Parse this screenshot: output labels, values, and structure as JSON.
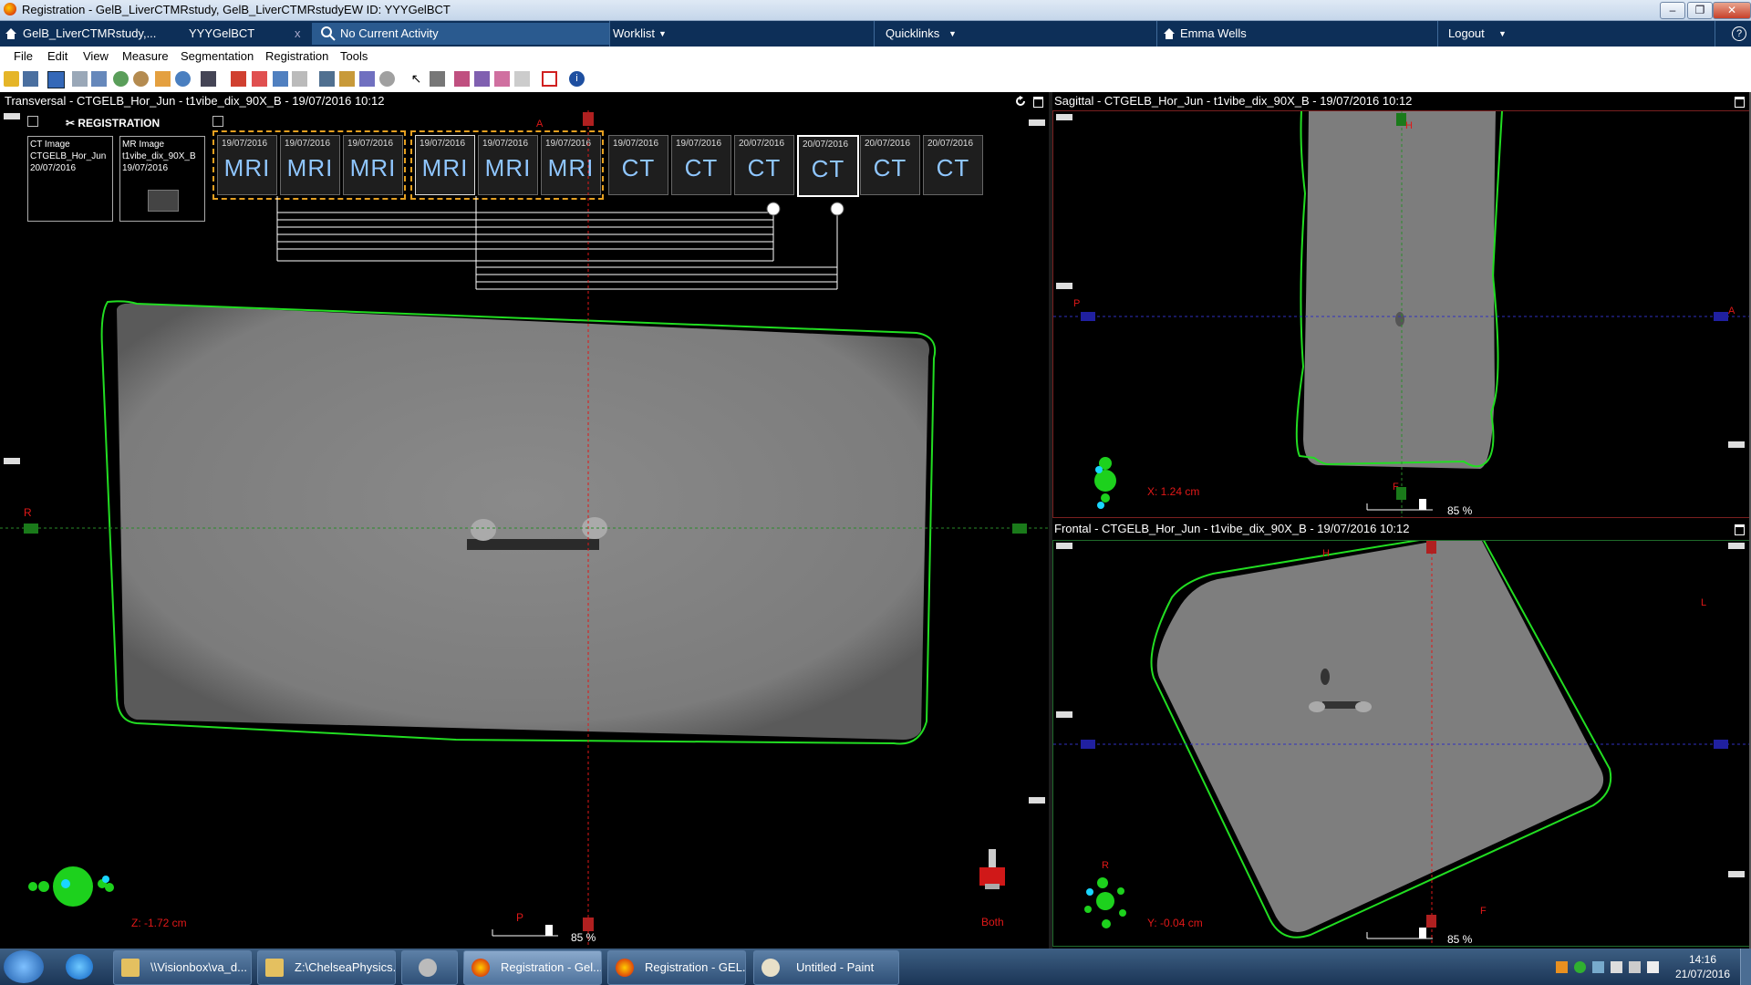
{
  "window": {
    "title": "Registration - GelB_LiverCTMRstudy, GelB_LiverCTMRstudyEW  ID: YYYGelBCT",
    "buttons": {
      "minimize": "–",
      "restore": "❐",
      "close": "✕"
    }
  },
  "navbar": {
    "patient_tab": "GelB_LiverCTMRstudy,...",
    "id_tab": "YYYGelBCT",
    "close_glyph": "x",
    "activity": "No Current Activity",
    "worklist": "Worklist",
    "quicklinks": "Quicklinks",
    "user": "Emma Wells",
    "logout": "Logout",
    "help": "?"
  },
  "menu": [
    "File",
    "Edit",
    "View",
    "Measure",
    "Segmentation",
    "Registration",
    "Tools"
  ],
  "transversal": {
    "header": "Transversal - CTGELB_Hor_Jun - t1vibe_dix_90X_B - 19/07/2016 10:12",
    "panel_title": "REGISTRATION",
    "ct_image": [
      "CT Image",
      "CTGELB_Hor_Jun",
      "20/07/2016"
    ],
    "mr_image": [
      "MR Image",
      "t1vibe_dix_90X_B",
      "19/07/2016"
    ],
    "thumbs": [
      {
        "date": "19/07/2016",
        "mod": "MRI"
      },
      {
        "date": "19/07/2016",
        "mod": "MRI"
      },
      {
        "date": "19/07/2016",
        "mod": "MRI"
      },
      {
        "date": "19/07/2016",
        "mod": "MRI"
      },
      {
        "date": "19/07/2016",
        "mod": "MRI"
      },
      {
        "date": "19/07/2016",
        "mod": "MRI"
      },
      {
        "date": "19/07/2016",
        "mod": "CT"
      },
      {
        "date": "19/07/2016",
        "mod": "CT"
      },
      {
        "date": "20/07/2016",
        "mod": "CT"
      },
      {
        "date": "20/07/2016",
        "mod": "CT"
      },
      {
        "date": "20/07/2016",
        "mod": "CT"
      },
      {
        "date": "20/07/2016",
        "mod": "CT"
      }
    ],
    "label_a": "A",
    "label_r": "R",
    "label_p": "P",
    "coord": "Z: -1.72 cm",
    "zoom": "85 %",
    "toggle_label": "Both"
  },
  "sagittal": {
    "header": "Sagittal - CTGELB_Hor_Jun - t1vibe_dix_90X_B - 19/07/2016 10:12",
    "label_h": "H",
    "label_p": "P",
    "label_a": "A",
    "label_f": "F",
    "coord": "X: 1.24 cm",
    "zoom": "85 %"
  },
  "frontal": {
    "header": "Frontal - CTGELB_Hor_Jun - t1vibe_dix_90X_B - 19/07/2016 10:12",
    "label_h": "H",
    "label_l": "L",
    "label_r": "R",
    "label_f": "F",
    "coord": "Y: -0.04 cm",
    "zoom": "85 %"
  },
  "taskbar": {
    "items": [
      "\\\\Visionbox\\va_d...",
      "Z:\\ChelseaPhysics...",
      "",
      "Registration - Gel...",
      "Registration - GEL...",
      "Untitled - Paint"
    ],
    "time": "14:16",
    "date": "21/07/2016"
  },
  "colors": {
    "nav_bg": "#0d2f58",
    "contour": "#22dd22",
    "crosshair_red": "#e01818",
    "crosshair_green": "#2a8a2a",
    "crosshair_blue": "#3030c0",
    "mri_group_border": "#e6a020"
  }
}
